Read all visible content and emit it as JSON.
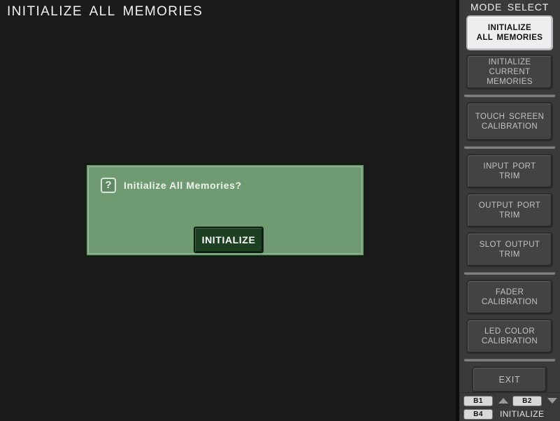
{
  "window": {
    "title": "INITIALIZE ALL MEMORIES",
    "background_color": "#1a1a1a"
  },
  "dialog": {
    "icon": "question-mark-icon",
    "icon_glyph": "?",
    "message": "Initialize All Memories?",
    "confirm_label": "INITIALIZE",
    "background_color": "#6f9a72",
    "confirm_button_color": "#1d4023"
  },
  "sidebar": {
    "header": "MODE SELECT",
    "items": [
      {
        "line1": "INITIALIZE",
        "line2": "ALL MEMORIES",
        "selected": true,
        "separator_after": false
      },
      {
        "line1": "INITIALIZE",
        "line2": "CURRENT MEMORIES",
        "selected": false,
        "separator_after": true
      },
      {
        "line1": "TOUCH SCREEN",
        "line2": "CALIBRATION",
        "selected": false,
        "separator_after": true
      },
      {
        "line1": "INPUT PORT",
        "line2": "TRIM",
        "selected": false,
        "separator_after": false
      },
      {
        "line1": "OUTPUT PORT",
        "line2": "TRIM",
        "selected": false,
        "separator_after": false
      },
      {
        "line1": "SLOT OUTPUT",
        "line2": "TRIM",
        "selected": false,
        "separator_after": true
      },
      {
        "line1": "FADER",
        "line2": "CALIBRATION",
        "selected": false,
        "separator_after": false
      },
      {
        "line1": "LED COLOR",
        "line2": "CALIBRATION",
        "selected": false,
        "separator_after": true
      }
    ],
    "exit_label": "EXIT",
    "selected_bg_color": "#eeeef0",
    "button_bg_color": "#434343"
  },
  "bank_strip": {
    "bank_b1": "B1",
    "bank_b2": "B2",
    "bank_b4": "B4",
    "status_label": "INITIALIZE",
    "up_arrow": "chevron-up-icon",
    "down_arrow": "chevron-down-icon"
  }
}
